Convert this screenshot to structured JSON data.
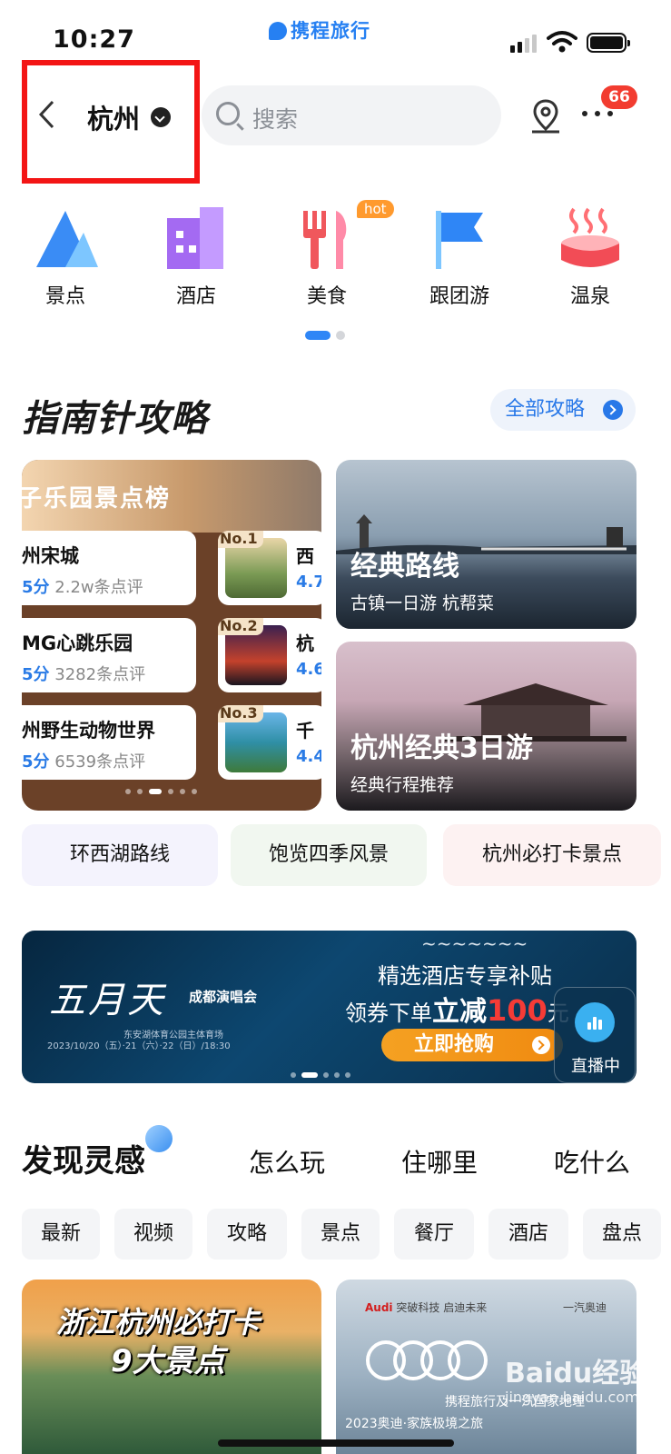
{
  "status_bar": {
    "time": "10:27",
    "brand": "携程旅行"
  },
  "header": {
    "city": "杭州",
    "search_placeholder": "搜索",
    "notification_count": "66"
  },
  "categories": [
    {
      "label": "景点",
      "icon": "mountain-icon"
    },
    {
      "label": "酒店",
      "icon": "hotel-icon"
    },
    {
      "label": "美食",
      "icon": "food-icon",
      "badge": "hot"
    },
    {
      "label": "跟团游",
      "icon": "flag-icon"
    },
    {
      "label": "温泉",
      "icon": "hot-spring-icon"
    }
  ],
  "guide": {
    "title": "指南针攻略",
    "all_label": "全部攻略",
    "ranking": {
      "title": "子乐园景点榜",
      "left_items": [
        {
          "name": "州宋城",
          "score": "5分",
          "reviews": "2.2w条点评"
        },
        {
          "name": "MG心跳乐园",
          "score": "5分",
          "reviews": "3282条点评"
        },
        {
          "name": "州野生动物世界",
          "score": "5分",
          "reviews": "6539条点评"
        }
      ],
      "right_items": [
        {
          "rank": "No.1",
          "name": "西",
          "score": "4.7"
        },
        {
          "rank": "No.2",
          "name": "杭",
          "score": "4.6"
        },
        {
          "rank": "No.3",
          "name": "千",
          "score": "4.4"
        }
      ]
    },
    "cards": [
      {
        "title": "经典路线",
        "subtitle": "古镇一日游 杭帮菜"
      },
      {
        "title": "杭州经典3日游",
        "subtitle": "经典行程推荐"
      }
    ],
    "tags": [
      "环西湖路线",
      "饱览四季风景",
      "杭州必打卡景点"
    ]
  },
  "banner": {
    "title": "五月天",
    "subtitle": "成都演唱会",
    "venue": "东安湖体育公园主体育场",
    "date": "2023/10/20（五）·21（六）·22（日）/18:30",
    "line1": "精选酒店专享补贴",
    "line2_prefix": "领券下单",
    "line2_bold": "立减",
    "line2_amount": "100",
    "line2_unit": "元",
    "button": "立即抢购",
    "live_label": "直播中"
  },
  "discover": {
    "title": "发现灵感",
    "tabs": [
      "怎么玩",
      "住哪里",
      "吃什么"
    ],
    "filters": [
      "最新",
      "视频",
      "攻略",
      "景点",
      "餐厅",
      "酒店",
      "盘点"
    ],
    "feed": [
      {
        "line1": "浙江杭州必打卡",
        "line2": "9大景点"
      },
      {
        "brand": "Audi",
        "brand_tagline": "突破科技 启迪未来",
        "right_tag": "一汽奥迪",
        "text1": "携程旅行及一汽国家地理",
        "text2": "2023奥迪·家族极境之旅"
      }
    ]
  },
  "watermark": {
    "text": "Baidu经验",
    "sub": "jingyan.baidu.com"
  },
  "colors": {
    "accent": "#2680f2",
    "highlight_box": "#f31515",
    "badge": "#f23c30"
  }
}
